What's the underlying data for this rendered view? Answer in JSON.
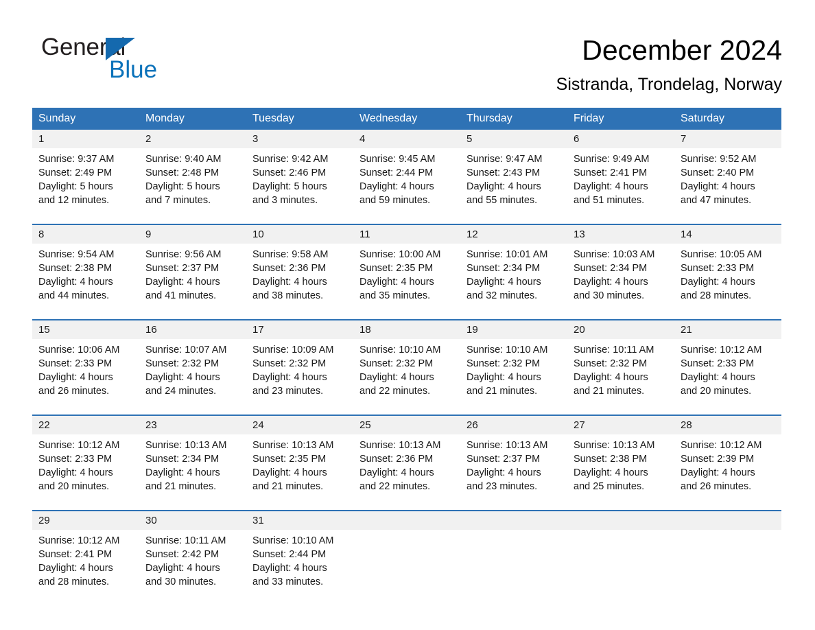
{
  "brand": {
    "name_part1": "General",
    "name_part2": "Blue",
    "triangle_color": "#1469ae",
    "blue_color": "#0b72ba"
  },
  "header": {
    "title": "December 2024",
    "subtitle": "Sistranda, Trondelag, Norway"
  },
  "theme": {
    "header_blue": "#2e72b5",
    "daynum_gray": "#f1f1f1",
    "text_black": "#1a1a1a"
  },
  "calendar": {
    "weekday_headers": [
      "Sunday",
      "Monday",
      "Tuesday",
      "Wednesday",
      "Thursday",
      "Friday",
      "Saturday"
    ],
    "weeks": [
      [
        {
          "day": "1",
          "sunrise": "Sunrise: 9:37 AM",
          "sunset": "Sunset: 2:49 PM",
          "daylight1": "Daylight: 5 hours",
          "daylight2": "and 12 minutes."
        },
        {
          "day": "2",
          "sunrise": "Sunrise: 9:40 AM",
          "sunset": "Sunset: 2:48 PM",
          "daylight1": "Daylight: 5 hours",
          "daylight2": "and 7 minutes."
        },
        {
          "day": "3",
          "sunrise": "Sunrise: 9:42 AM",
          "sunset": "Sunset: 2:46 PM",
          "daylight1": "Daylight: 5 hours",
          "daylight2": "and 3 minutes."
        },
        {
          "day": "4",
          "sunrise": "Sunrise: 9:45 AM",
          "sunset": "Sunset: 2:44 PM",
          "daylight1": "Daylight: 4 hours",
          "daylight2": "and 59 minutes."
        },
        {
          "day": "5",
          "sunrise": "Sunrise: 9:47 AM",
          "sunset": "Sunset: 2:43 PM",
          "daylight1": "Daylight: 4 hours",
          "daylight2": "and 55 minutes."
        },
        {
          "day": "6",
          "sunrise": "Sunrise: 9:49 AM",
          "sunset": "Sunset: 2:41 PM",
          "daylight1": "Daylight: 4 hours",
          "daylight2": "and 51 minutes."
        },
        {
          "day": "7",
          "sunrise": "Sunrise: 9:52 AM",
          "sunset": "Sunset: 2:40 PM",
          "daylight1": "Daylight: 4 hours",
          "daylight2": "and 47 minutes."
        }
      ],
      [
        {
          "day": "8",
          "sunrise": "Sunrise: 9:54 AM",
          "sunset": "Sunset: 2:38 PM",
          "daylight1": "Daylight: 4 hours",
          "daylight2": "and 44 minutes."
        },
        {
          "day": "9",
          "sunrise": "Sunrise: 9:56 AM",
          "sunset": "Sunset: 2:37 PM",
          "daylight1": "Daylight: 4 hours",
          "daylight2": "and 41 minutes."
        },
        {
          "day": "10",
          "sunrise": "Sunrise: 9:58 AM",
          "sunset": "Sunset: 2:36 PM",
          "daylight1": "Daylight: 4 hours",
          "daylight2": "and 38 minutes."
        },
        {
          "day": "11",
          "sunrise": "Sunrise: 10:00 AM",
          "sunset": "Sunset: 2:35 PM",
          "daylight1": "Daylight: 4 hours",
          "daylight2": "and 35 minutes."
        },
        {
          "day": "12",
          "sunrise": "Sunrise: 10:01 AM",
          "sunset": "Sunset: 2:34 PM",
          "daylight1": "Daylight: 4 hours",
          "daylight2": "and 32 minutes."
        },
        {
          "day": "13",
          "sunrise": "Sunrise: 10:03 AM",
          "sunset": "Sunset: 2:34 PM",
          "daylight1": "Daylight: 4 hours",
          "daylight2": "and 30 minutes."
        },
        {
          "day": "14",
          "sunrise": "Sunrise: 10:05 AM",
          "sunset": "Sunset: 2:33 PM",
          "daylight1": "Daylight: 4 hours",
          "daylight2": "and 28 minutes."
        }
      ],
      [
        {
          "day": "15",
          "sunrise": "Sunrise: 10:06 AM",
          "sunset": "Sunset: 2:33 PM",
          "daylight1": "Daylight: 4 hours",
          "daylight2": "and 26 minutes."
        },
        {
          "day": "16",
          "sunrise": "Sunrise: 10:07 AM",
          "sunset": "Sunset: 2:32 PM",
          "daylight1": "Daylight: 4 hours",
          "daylight2": "and 24 minutes."
        },
        {
          "day": "17",
          "sunrise": "Sunrise: 10:09 AM",
          "sunset": "Sunset: 2:32 PM",
          "daylight1": "Daylight: 4 hours",
          "daylight2": "and 23 minutes."
        },
        {
          "day": "18",
          "sunrise": "Sunrise: 10:10 AM",
          "sunset": "Sunset: 2:32 PM",
          "daylight1": "Daylight: 4 hours",
          "daylight2": "and 22 minutes."
        },
        {
          "day": "19",
          "sunrise": "Sunrise: 10:10 AM",
          "sunset": "Sunset: 2:32 PM",
          "daylight1": "Daylight: 4 hours",
          "daylight2": "and 21 minutes."
        },
        {
          "day": "20",
          "sunrise": "Sunrise: 10:11 AM",
          "sunset": "Sunset: 2:32 PM",
          "daylight1": "Daylight: 4 hours",
          "daylight2": "and 21 minutes."
        },
        {
          "day": "21",
          "sunrise": "Sunrise: 10:12 AM",
          "sunset": "Sunset: 2:33 PM",
          "daylight1": "Daylight: 4 hours",
          "daylight2": "and 20 minutes."
        }
      ],
      [
        {
          "day": "22",
          "sunrise": "Sunrise: 10:12 AM",
          "sunset": "Sunset: 2:33 PM",
          "daylight1": "Daylight: 4 hours",
          "daylight2": "and 20 minutes."
        },
        {
          "day": "23",
          "sunrise": "Sunrise: 10:13 AM",
          "sunset": "Sunset: 2:34 PM",
          "daylight1": "Daylight: 4 hours",
          "daylight2": "and 21 minutes."
        },
        {
          "day": "24",
          "sunrise": "Sunrise: 10:13 AM",
          "sunset": "Sunset: 2:35 PM",
          "daylight1": "Daylight: 4 hours",
          "daylight2": "and 21 minutes."
        },
        {
          "day": "25",
          "sunrise": "Sunrise: 10:13 AM",
          "sunset": "Sunset: 2:36 PM",
          "daylight1": "Daylight: 4 hours",
          "daylight2": "and 22 minutes."
        },
        {
          "day": "26",
          "sunrise": "Sunrise: 10:13 AM",
          "sunset": "Sunset: 2:37 PM",
          "daylight1": "Daylight: 4 hours",
          "daylight2": "and 23 minutes."
        },
        {
          "day": "27",
          "sunrise": "Sunrise: 10:13 AM",
          "sunset": "Sunset: 2:38 PM",
          "daylight1": "Daylight: 4 hours",
          "daylight2": "and 25 minutes."
        },
        {
          "day": "28",
          "sunrise": "Sunrise: 10:12 AM",
          "sunset": "Sunset: 2:39 PM",
          "daylight1": "Daylight: 4 hours",
          "daylight2": "and 26 minutes."
        }
      ],
      [
        {
          "day": "29",
          "sunrise": "Sunrise: 10:12 AM",
          "sunset": "Sunset: 2:41 PM",
          "daylight1": "Daylight: 4 hours",
          "daylight2": "and 28 minutes."
        },
        {
          "day": "30",
          "sunrise": "Sunrise: 10:11 AM",
          "sunset": "Sunset: 2:42 PM",
          "daylight1": "Daylight: 4 hours",
          "daylight2": "and 30 minutes."
        },
        {
          "day": "31",
          "sunrise": "Sunrise: 10:10 AM",
          "sunset": "Sunset: 2:44 PM",
          "daylight1": "Daylight: 4 hours",
          "daylight2": "and 33 minutes."
        },
        {
          "day": "",
          "sunrise": "",
          "sunset": "",
          "daylight1": "",
          "daylight2": ""
        },
        {
          "day": "",
          "sunrise": "",
          "sunset": "",
          "daylight1": "",
          "daylight2": ""
        },
        {
          "day": "",
          "sunrise": "",
          "sunset": "",
          "daylight1": "",
          "daylight2": ""
        },
        {
          "day": "",
          "sunrise": "",
          "sunset": "",
          "daylight1": "",
          "daylight2": ""
        }
      ]
    ]
  }
}
